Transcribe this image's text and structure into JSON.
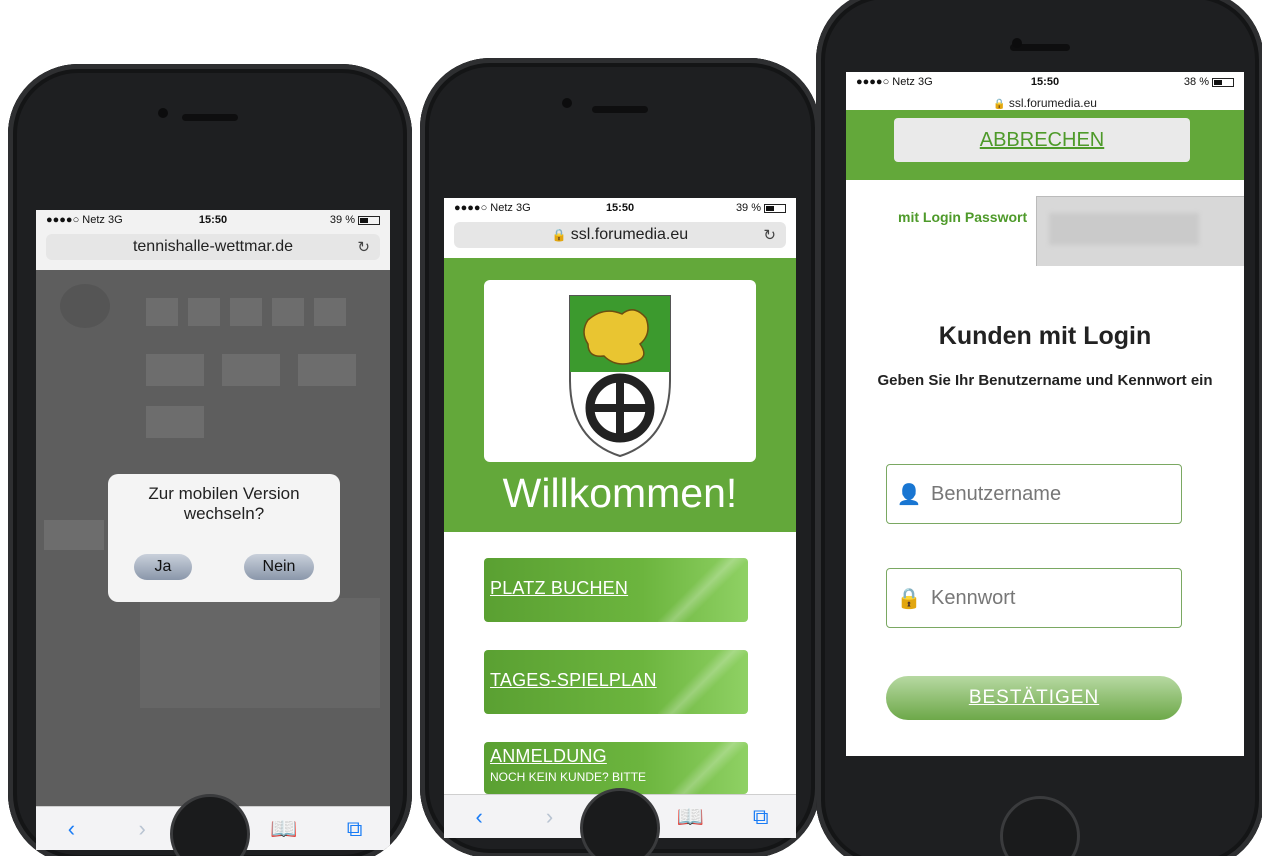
{
  "phones": [
    {
      "status": {
        "carrier": "●●●●○ Netz  3G",
        "time": "15:50",
        "battery": "39 %"
      },
      "url": "tennishalle-wettmar.de",
      "dialog": {
        "question": "Zur mobilen Version wechseln?",
        "yes": "Ja",
        "no": "Nein"
      }
    },
    {
      "status": {
        "carrier": "●●●●○ Netz  3G",
        "time": "15:50",
        "battery": "39 %"
      },
      "url": "ssl.forumedia.eu",
      "welcome": "Willkommen!",
      "buttons": {
        "book": "PLATZ BUCHEN",
        "plan": "TAGES-SPIELPLAN",
        "register": "ANMELDUNG",
        "register_sub": "NOCH KEIN KUNDE? BITTE"
      }
    },
    {
      "status": {
        "carrier": "●●●●○ Netz  3G",
        "time": "15:50",
        "battery": "38 %"
      },
      "url": "ssl.forumedia.eu",
      "cancel": "ABBRECHEN",
      "tab_login": "mit Login Passwort",
      "heading": "Kunden mit Login",
      "subheading": "Geben Sie Ihr Benutzername und Kennwort ein",
      "username_placeholder": "Benutzername",
      "password_placeholder": "Kennwort",
      "confirm": "BESTÄTIGEN"
    }
  ],
  "toolbar_icons": [
    "back-icon",
    "forward-icon",
    "share-icon",
    "bookmarks-icon",
    "tabs-icon"
  ],
  "colors": {
    "green": "#63a83a",
    "link_green": "#4e9a2a",
    "ios_blue": "#1a7cf5"
  }
}
